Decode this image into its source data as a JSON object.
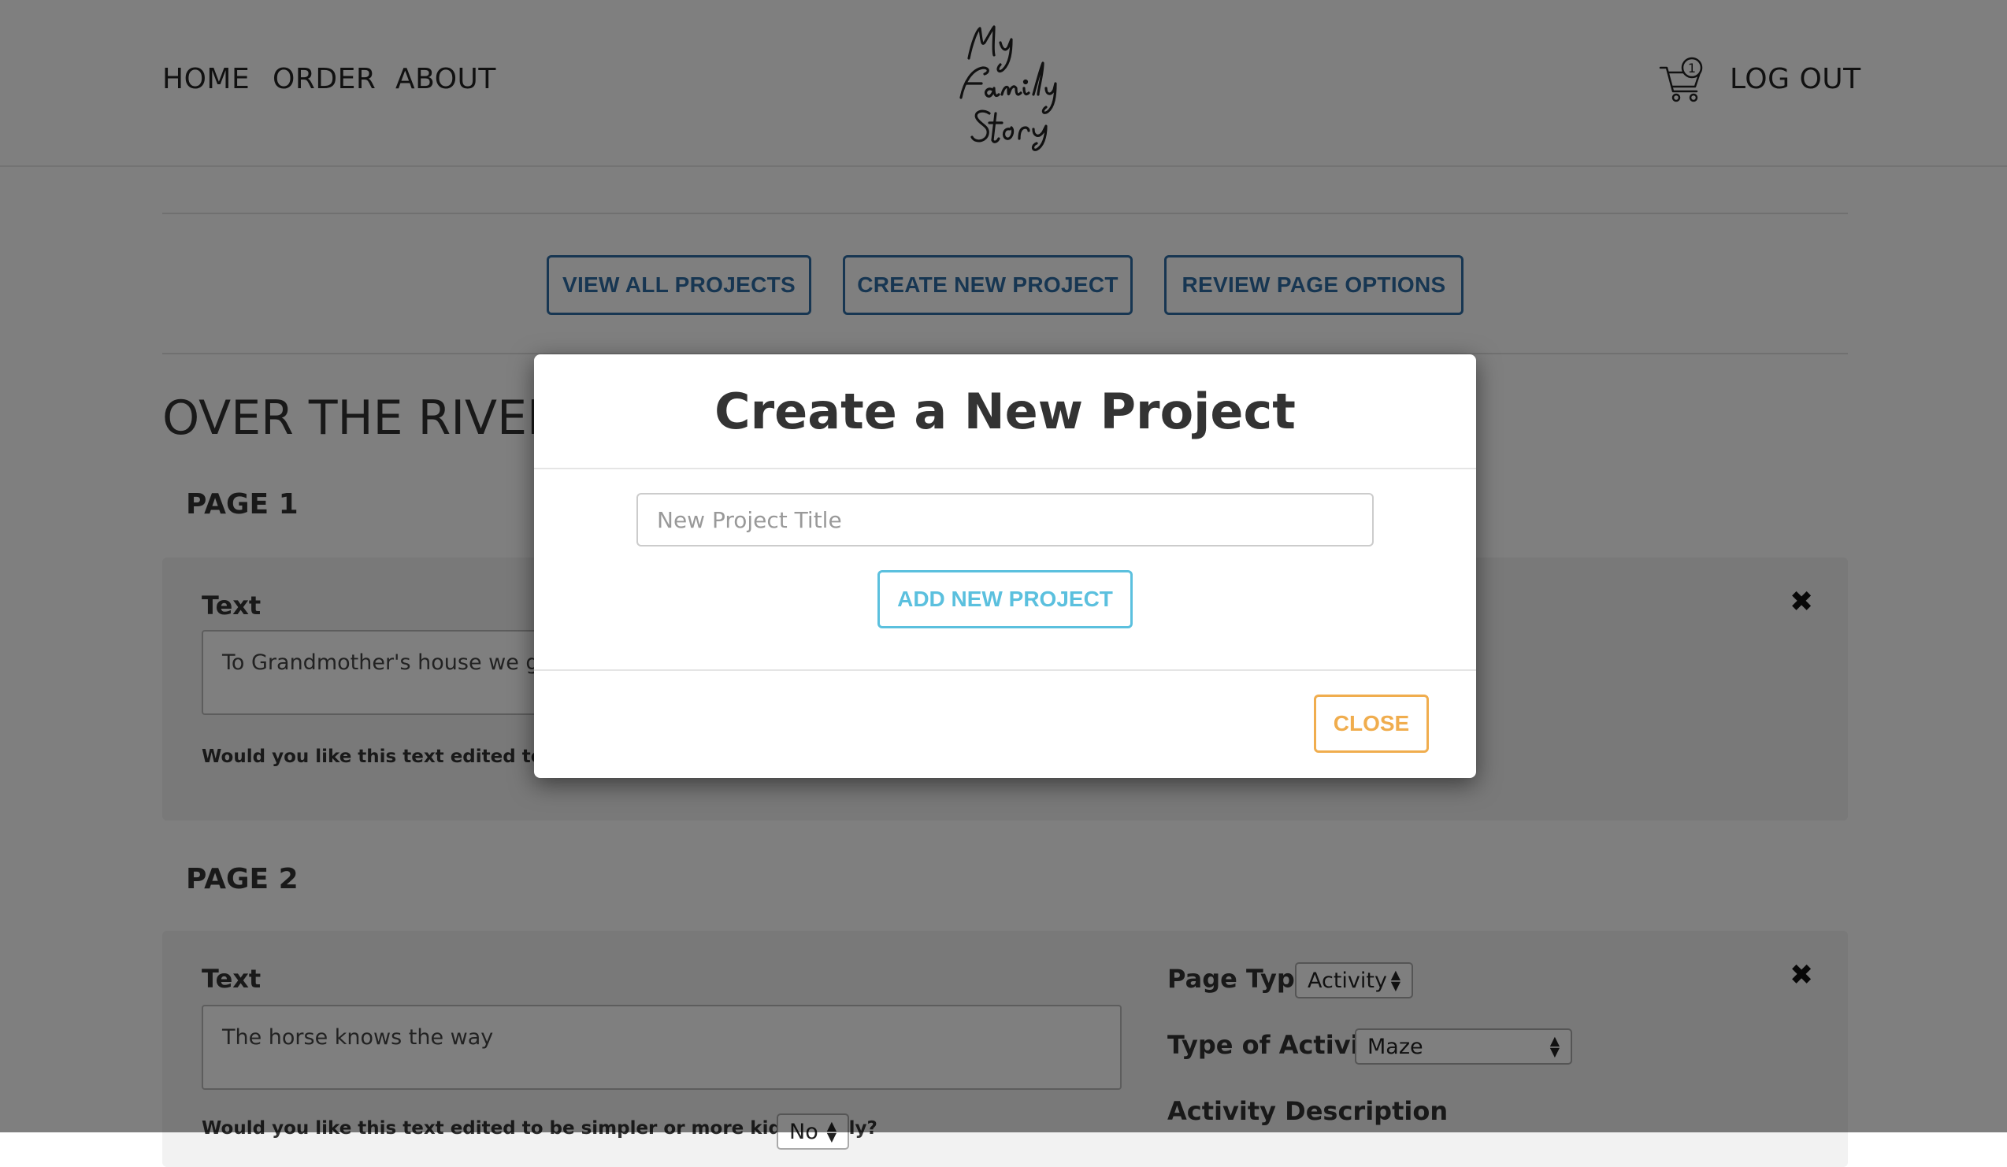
{
  "header": {
    "nav": {
      "home": "HOME",
      "order": "ORDER",
      "about": "ABOUT"
    },
    "logo_text": "My Family Story",
    "cart_count": "1",
    "logout": "LOG OUT"
  },
  "actions": {
    "view_all": "VIEW ALL PROJECTS",
    "create_new": "CREATE NEW PROJECT",
    "review_options": "REVIEW PAGE OPTIONS"
  },
  "project": {
    "title": "OVER THE RIVER AND THROUGH THE WOODS"
  },
  "pages": [
    {
      "heading": "PAGE 1",
      "text_label": "Text",
      "text_value": "To Grandmother's house we go",
      "question": "Would you like this text edited to be simpler or more kid friendly?"
    },
    {
      "heading": "PAGE 2",
      "text_label": "Text",
      "text_value": "The horse knows the way",
      "question": "Would you like this text edited to be simpler or more kid friendly?",
      "question_value": "No",
      "page_type_label": "Page Type",
      "page_type_value": "Activity",
      "activity_type_label": "Type of Activity",
      "activity_type_value": "Maze",
      "activity_desc_label": "Activity Description"
    }
  ],
  "modal": {
    "title": "Create a New Project",
    "input_placeholder": "New Project Title",
    "add_button": "ADD NEW PROJECT",
    "close_button": "CLOSE"
  },
  "colors": {
    "primary_outline": "#2e6da4",
    "info_outline": "#5bc0de",
    "warning_outline": "#f0ad4e",
    "overlay": "rgba(0,0,0,0.5)"
  },
  "icons": {
    "cart": "cart-icon",
    "remove": "remove-icon",
    "logo": "logo-icon"
  }
}
